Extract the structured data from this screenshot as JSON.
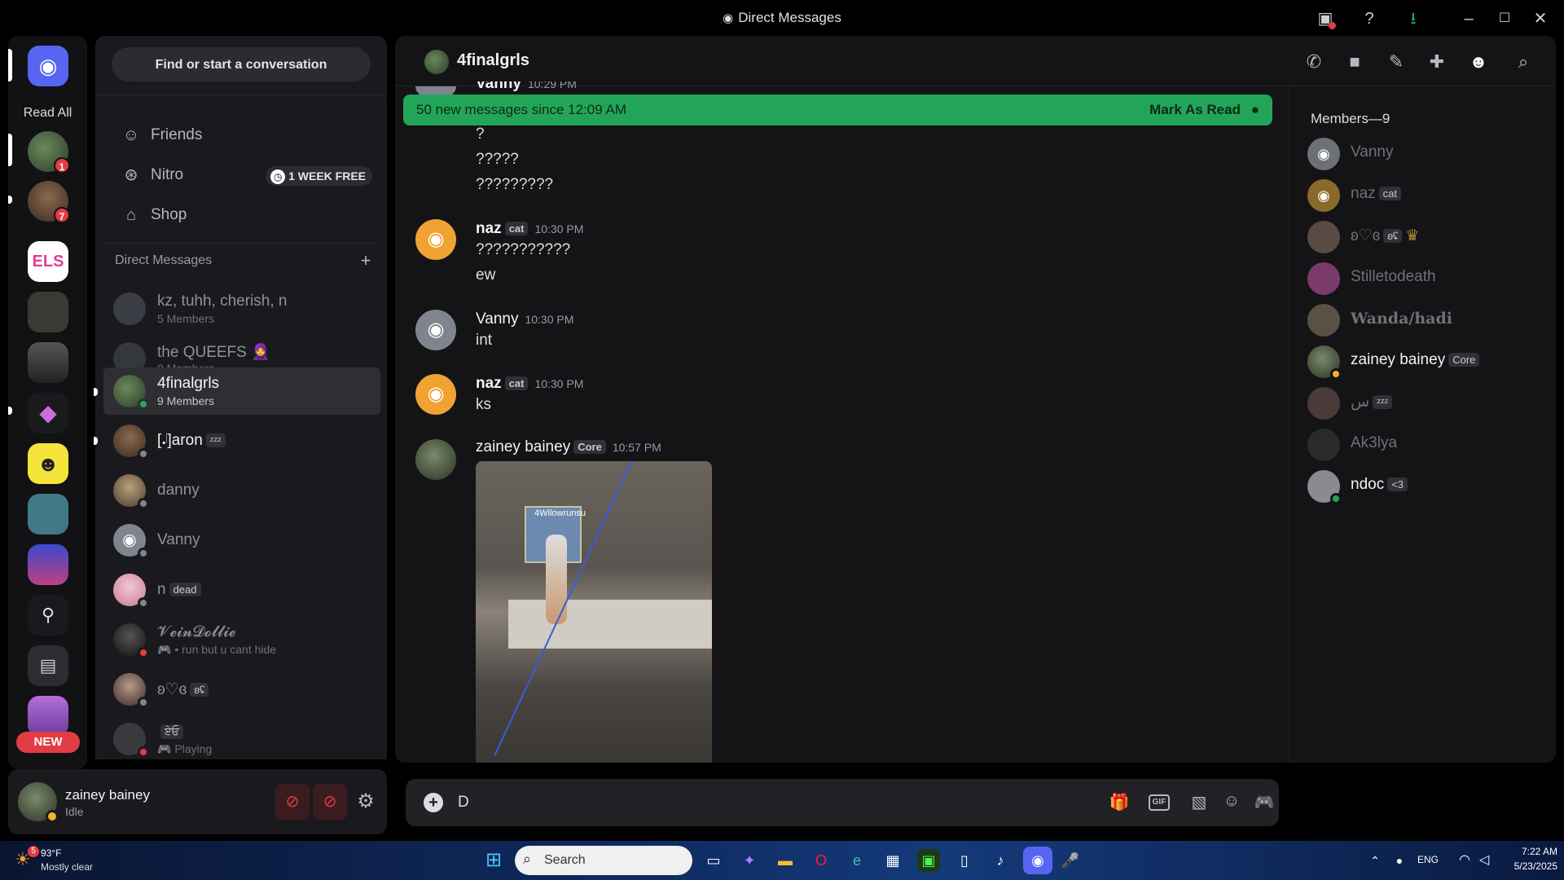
{
  "window": {
    "title": "Direct Messages"
  },
  "rail": {
    "read_all": "Read All",
    "badges": [
      "1",
      "7"
    ],
    "new_label": "NEW"
  },
  "dm_panel": {
    "search_label": "Find or start a conversation",
    "nav": [
      {
        "label": "Friends"
      },
      {
        "label": "Nitro",
        "promo": "1 WEEK FREE"
      },
      {
        "label": "Shop"
      }
    ],
    "section_title": "Direct Messages",
    "dms": [
      {
        "name": "kz, tuhh, cherish, n",
        "sub": "5 Members"
      },
      {
        "name": "the QUEEFS 🧕",
        "sub": "8 Members"
      },
      {
        "name": "4finalgrls",
        "sub": "9 Members"
      },
      {
        "name": "[𝆺𝅥]aron",
        "tag": "ᶻᶻᶻ"
      },
      {
        "name": "danny"
      },
      {
        "name": "Vanny"
      },
      {
        "name": "n",
        "tag": "dead"
      },
      {
        "name": "𝓥𝓮𝓲𝓷𝓓𝓸𝓵𝓵𝓲𝓮",
        "sub": "• run but u cant hide"
      },
      {
        "name": "ʚ♡ɞ",
        "tag": "ʚʢ"
      },
      {
        "name": "",
        "tag": "ਏਓ",
        "sub": "Playing"
      }
    ]
  },
  "user_panel": {
    "name": "zainey bainey",
    "status": "Idle"
  },
  "chat": {
    "channel_name": "4finalgrls",
    "banner_text": "50 new messages since 12:09 AM",
    "banner_action": "Mark As Read",
    "cut_name": "Vanny",
    "cut_time": "10:29 PM",
    "pre_lines": [
      "?",
      "?????",
      "?????????"
    ],
    "messages": [
      {
        "author": "naz",
        "tag": "cat",
        "time": "10:30 PM",
        "lines": [
          "???????????",
          "ew"
        ]
      },
      {
        "author": "Vanny",
        "time": "10:30 PM",
        "lines": [
          "int"
        ]
      },
      {
        "author": "naz",
        "tag": "cat",
        "time": "10:30 PM",
        "lines": [
          "ks"
        ]
      },
      {
        "author": "zainey bainey",
        "tag": "Core",
        "time": "10:57 PM",
        "lines": []
      }
    ],
    "image_caption": "4Wilowrunsu",
    "composer_value": "D"
  },
  "members": {
    "header": "Members—9",
    "list": [
      {
        "name": "Vanny"
      },
      {
        "name": "naz",
        "tag": "cat"
      },
      {
        "name": "ʚ♡ɞ",
        "tag": "ʚʢ"
      },
      {
        "name": "Stilletodeath"
      },
      {
        "name": "Wanda/hadi"
      },
      {
        "name": "zainey bainey",
        "tag": "Core"
      },
      {
        "name": "س",
        "tag": "ᶻᶻᶻ"
      },
      {
        "name": "Ak3lya"
      },
      {
        "name": "ndoc",
        "tag": "<3"
      }
    ]
  },
  "taskbar": {
    "weather_temp": "93°F",
    "weather_desc": "Mostly clear",
    "weather_badge": "5",
    "search_label": "Search",
    "lang": "ENG",
    "time": "7:22 AM",
    "date": "5/23/2025"
  },
  "colors": {
    "accent": "#5865f2",
    "banner": "#23a559",
    "danger": "#e23c45"
  }
}
